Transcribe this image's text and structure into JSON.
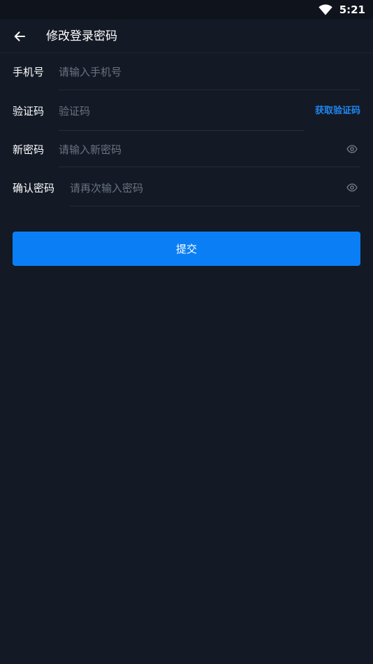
{
  "status_bar": {
    "time": "5:21",
    "icons": [
      "wifi-icon"
    ]
  },
  "header": {
    "back_icon": "arrow-left-icon",
    "title": "修改登录密码"
  },
  "form": {
    "phone": {
      "label": "手机号",
      "placeholder": "请输入手机号"
    },
    "code": {
      "label": "验证码",
      "placeholder": "验证码",
      "button": "获取验证码"
    },
    "new_password": {
      "label": "新密码",
      "placeholder": "请输入新密码",
      "icon": "eye-icon"
    },
    "confirm_password": {
      "label": "确认密码",
      "placeholder": "请再次输入密码",
      "icon": "eye-icon"
    }
  },
  "submit_label": "提交",
  "colors": {
    "background": "#131a26",
    "status_bar": "#0f131c",
    "accent": "#0a7ff5",
    "link": "#1f86f0",
    "placeholder": "#6b7380",
    "divider": "#252c3a"
  }
}
